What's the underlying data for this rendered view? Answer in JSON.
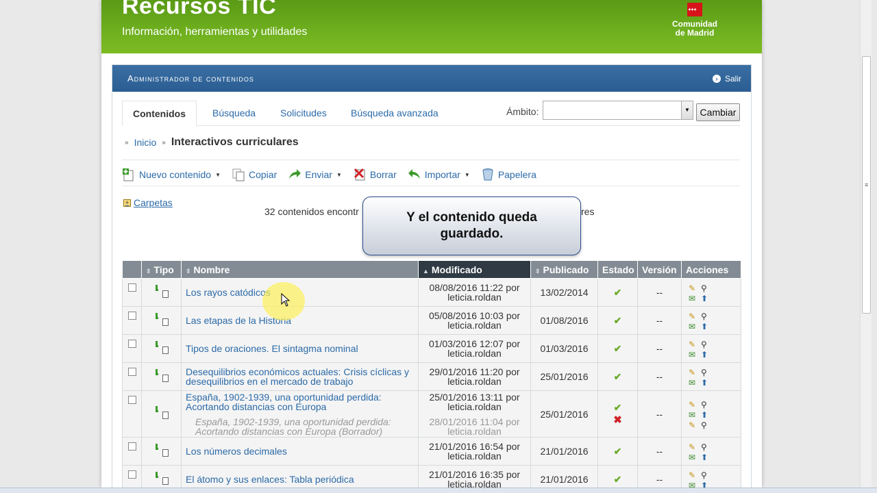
{
  "banner": {
    "title": "Recursos TIC",
    "subtitle": "Información, herramientas y utilidades",
    "logo_line1": "Comunidad",
    "logo_line2": "de Madrid"
  },
  "panel": {
    "title": "Administrador de contenidos",
    "exit_label": "Salir"
  },
  "tabs": [
    {
      "label": "Contenidos",
      "active": true
    },
    {
      "label": "Búsqueda",
      "active": false
    },
    {
      "label": "Solicitudes",
      "active": false
    },
    {
      "label": "Búsqueda avanzada",
      "active": false
    }
  ],
  "scope": {
    "label": "Ámbito:",
    "value": "",
    "button": "Cambiar"
  },
  "breadcrumb": {
    "home": "Inicio",
    "current": "Interactivos curriculares"
  },
  "toolbar": {
    "new": "Nuevo contenido",
    "copy": "Copiar",
    "send": "Enviar",
    "delete": "Borrar",
    "import": "Importar",
    "trash": "Papelera"
  },
  "folders_label": "Carpetas",
  "results": {
    "count_text_left": "32 contenidos encontr",
    "count_text_right": "res"
  },
  "callout": {
    "line1": "Y el contenido queda",
    "line2": "guardado."
  },
  "table": {
    "headers": {
      "type": "Tipo",
      "name": "Nombre",
      "modified": "Modificado",
      "published": "Publicado",
      "state": "Estado",
      "version": "Versión",
      "actions": "Acciones"
    },
    "rows": [
      {
        "name_1": "Los rayos catódicos",
        "name_2": "",
        "mod_1": "08/08/2016 11:22 por",
        "mod_2": "leticia.roldan",
        "published": "13/02/2014",
        "version": "--"
      },
      {
        "name_1": "Las etapas de la Historia",
        "name_2": "",
        "mod_1": "05/08/2016 10:03 por",
        "mod_2": "leticia.roldan",
        "published": "01/08/2016",
        "version": "--"
      },
      {
        "name_1": "Tipos de oraciones. El sintagma nominal",
        "name_2": "",
        "mod_1": "01/03/2016 12:07 por",
        "mod_2": "leticia.roldan",
        "published": "01/03/2016",
        "version": "--"
      },
      {
        "name_1": "Desequilibrios económicos actuales: Crisis cíclicas y",
        "name_2": "desequilibrios en el mercado de trabajo",
        "mod_1": "29/01/2016 11:20 por",
        "mod_2": "leticia.roldan",
        "published": "25/01/2016",
        "version": "--"
      },
      {
        "name_1": "España, 1902-1939, una oportunidad perdida:",
        "name_2": "Acortando distancias con Europa",
        "mod_1": "25/01/2016 13:11 por",
        "mod_2": "leticia.roldan",
        "published": "25/01/2016",
        "version": "--",
        "draft_1": "España, 1902-1939, una oportunidad perdida:",
        "draft_2": "Acortando distancias con Europa (Borrador)",
        "draft_mod_1": "28/01/2016 11:04 por",
        "draft_mod_2": "leticia.roldan"
      },
      {
        "name_1": "Los números decimales",
        "name_2": "",
        "mod_1": "21/01/2016 16:54 por",
        "mod_2": "leticia.roldan",
        "published": "21/01/2016",
        "version": "--"
      },
      {
        "name_1": "El átomo y sus enlaces: Tabla periódica",
        "name_2": "",
        "mod_1": "21/01/2016 16:35 por",
        "mod_2": "leticia.roldan",
        "published": "21/01/2016",
        "version": "--"
      }
    ]
  },
  "colors": {
    "banner_green": "#6fb01f",
    "panel_blue": "#2a5d92",
    "link_blue": "#2b6aa8",
    "header_gray": "#838c94",
    "sorted_header": "#2f3a44"
  }
}
